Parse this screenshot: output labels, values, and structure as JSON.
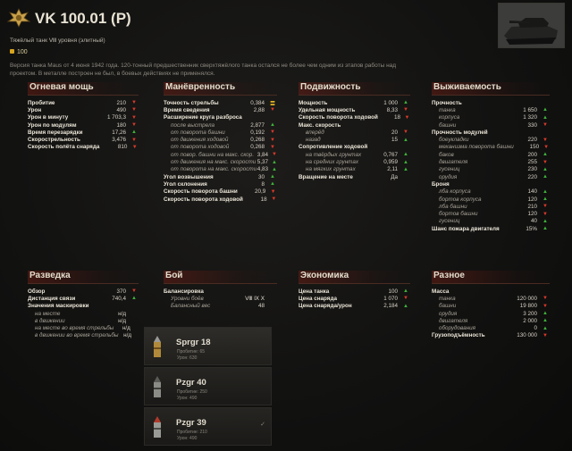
{
  "header": {
    "title": "VK 100.01 (P)",
    "subtitle": "Тяжёлый танк Ⅷ уровня (элитный)",
    "price": "100",
    "description": "Версия танка Maus от 4 июня 1942 года. 120-тонный предшественник сверхтяжёлого танка остался не более чем одним из этапов работы над проектом. В металле построен не был, в боевых действиях не применялся."
  },
  "sections": [
    {
      "id": "firepower",
      "title": "Огневая мощь",
      "rows": [
        {
          "label": "Пробитие",
          "value": "210",
          "ind": "down",
          "type": "bold"
        },
        {
          "label": "Урон",
          "value": "490",
          "ind": "down",
          "type": "bold"
        },
        {
          "label": "Урон в минуту",
          "value": "1 703,3",
          "ind": "down",
          "type": "bold"
        },
        {
          "label": "Урон по модулям",
          "value": "180",
          "ind": "down",
          "type": "bold"
        },
        {
          "label": "Время перезарядки",
          "value": "17,26",
          "ind": "up",
          "type": "bold"
        },
        {
          "label": "Скорострельность",
          "value": "3,476",
          "ind": "down",
          "type": "bold"
        },
        {
          "label": "Скорость полёта снаряда",
          "value": "810",
          "ind": "down",
          "type": "bold"
        }
      ]
    },
    {
      "id": "mobility",
      "title": "Манёвренность",
      "rows": [
        {
          "label": "Точность стрельбы",
          "value": "0,384",
          "ind": "eq",
          "type": "bold"
        },
        {
          "label": "Время сведения",
          "value": "2,88",
          "ind": "down",
          "type": "bold"
        },
        {
          "label": "Расширение круга разброса",
          "value": "",
          "ind": "",
          "type": "bold"
        },
        {
          "label": "после выстрела",
          "value": "2,877",
          "ind": "up",
          "type": "sub"
        },
        {
          "label": "от поворота башни",
          "value": "0,192",
          "ind": "down",
          "type": "sub"
        },
        {
          "label": "от движения ходовой",
          "value": "0,268",
          "ind": "down",
          "type": "sub"
        },
        {
          "label": "от поворота ходовой",
          "value": "0,268",
          "ind": "down",
          "type": "sub"
        },
        {
          "label": "от повор. башни на макс. скор.",
          "value": "3,84",
          "ind": "down",
          "type": "sub"
        },
        {
          "label": "от движения на макс. скорости",
          "value": "5,37",
          "ind": "up",
          "type": "sub"
        },
        {
          "label": "от поворота на макс. скорости",
          "value": "4,83",
          "ind": "up",
          "type": "sub"
        },
        {
          "label": "Угол возвышения",
          "value": "30",
          "ind": "up",
          "type": "bold"
        },
        {
          "label": "Угол склонения",
          "value": "8",
          "ind": "up",
          "type": "bold"
        },
        {
          "label": "Скорость поворота башни",
          "value": "20,9",
          "ind": "down",
          "type": "bold"
        },
        {
          "label": "Скорость поворота ходовой",
          "value": "18",
          "ind": "down",
          "type": "bold"
        }
      ]
    },
    {
      "id": "speed",
      "title": "Подвижность",
      "rows": [
        {
          "label": "Мощность",
          "value": "1 000",
          "ind": "up",
          "type": "bold"
        },
        {
          "label": "Удельная мощность",
          "value": "8,33",
          "ind": "down",
          "type": "bold"
        },
        {
          "label": "Скорость поворота ходовой",
          "value": "18",
          "ind": "down",
          "type": "bold"
        },
        {
          "label": "Макс. скорость",
          "value": "",
          "ind": "",
          "type": "bold"
        },
        {
          "label": "вперёд",
          "value": "20",
          "ind": "down",
          "type": "sub"
        },
        {
          "label": "назад",
          "value": "15",
          "ind": "up",
          "type": "sub"
        },
        {
          "label": "Сопротивление ходовой",
          "value": "",
          "ind": "",
          "type": "bold"
        },
        {
          "label": "на твёрдых грунтах",
          "value": "0,767",
          "ind": "up",
          "type": "sub"
        },
        {
          "label": "на средних грунтах",
          "value": "0,959",
          "ind": "up",
          "type": "sub"
        },
        {
          "label": "на мягких грунтах",
          "value": "2,11",
          "ind": "up",
          "type": "sub"
        },
        {
          "label": "Вращение на месте",
          "value": "Да",
          "ind": "",
          "type": "bold"
        }
      ]
    },
    {
      "id": "survivability",
      "title": "Выживаемость",
      "rows": [
        {
          "label": "Прочность",
          "value": "",
          "ind": "",
          "type": "bold"
        },
        {
          "label": "танка",
          "value": "1 650",
          "ind": "up",
          "type": "sub"
        },
        {
          "label": "корпуса",
          "value": "1 320",
          "ind": "up",
          "type": "sub"
        },
        {
          "label": "башни",
          "value": "330",
          "ind": "down",
          "type": "sub"
        },
        {
          "label": "Прочность модулей",
          "value": "",
          "ind": "",
          "type": "bold"
        },
        {
          "label": "боеукладки",
          "value": "220",
          "ind": "down",
          "type": "sub"
        },
        {
          "label": "механизма поворота башни",
          "value": "150",
          "ind": "down",
          "type": "sub"
        },
        {
          "label": "баков",
          "value": "200",
          "ind": "up",
          "type": "sub"
        },
        {
          "label": "двигателя",
          "value": "255",
          "ind": "down",
          "type": "sub"
        },
        {
          "label": "гусениц",
          "value": "230",
          "ind": "up",
          "type": "sub"
        },
        {
          "label": "орудия",
          "value": "220",
          "ind": "up",
          "type": "sub"
        },
        {
          "label": "Броня",
          "value": "",
          "ind": "",
          "type": "bold"
        },
        {
          "label": "лба корпуса",
          "value": "140",
          "ind": "up",
          "type": "sub"
        },
        {
          "label": "бортов корпуса",
          "value": "120",
          "ind": "up",
          "type": "sub"
        },
        {
          "label": "лба башни",
          "value": "210",
          "ind": "down",
          "type": "sub"
        },
        {
          "label": "бортов башни",
          "value": "120",
          "ind": "down",
          "type": "sub"
        },
        {
          "label": "гусениц",
          "value": "40",
          "ind": "up",
          "type": "sub"
        },
        {
          "label": "Шанс пожара двигателя",
          "value": "15%",
          "ind": "up",
          "type": "bold"
        }
      ]
    },
    {
      "id": "recon",
      "title": "Разведка",
      "rows": [
        {
          "label": "Обзор",
          "value": "370",
          "ind": "down",
          "type": "bold"
        },
        {
          "label": "Дистанция связи",
          "value": "740,4",
          "ind": "up",
          "type": "bold"
        },
        {
          "label": "Значения маскировки",
          "value": "",
          "ind": "",
          "type": "bold"
        },
        {
          "label": "на месте",
          "value": "н/д",
          "ind": "",
          "type": "sub"
        },
        {
          "label": "в движении",
          "value": "н/д",
          "ind": "",
          "type": "sub"
        },
        {
          "label": "на месте во время стрельбы",
          "value": "н/д",
          "ind": "",
          "type": "sub"
        },
        {
          "label": "в движении во время стрельбы",
          "value": "н/д",
          "ind": "",
          "type": "sub"
        }
      ]
    },
    {
      "id": "battle",
      "title": "Бой",
      "rows": [
        {
          "label": "Балансировка",
          "value": "",
          "ind": "",
          "type": "bold"
        },
        {
          "label": "Уровни боёв",
          "value": "Ⅷ Ⅸ Ⅹ",
          "ind": "",
          "type": "sub"
        },
        {
          "label": "Балансный вес",
          "value": "48",
          "ind": "",
          "type": "sub"
        }
      ]
    },
    {
      "id": "economy",
      "title": "Экономика",
      "rows": [
        {
          "label": "Цена танка",
          "value": "100",
          "ind": "up",
          "type": "bold"
        },
        {
          "label": "Цена снаряда",
          "value": "1 070",
          "ind": "down",
          "type": "bold"
        },
        {
          "label": "Цена снаряда/урон",
          "value": "2,184",
          "ind": "up",
          "type": "bold"
        }
      ]
    },
    {
      "id": "misc",
      "title": "Разное",
      "rows": [
        {
          "label": "Масса",
          "value": "",
          "ind": "",
          "type": "bold"
        },
        {
          "label": "танка",
          "value": "120 000",
          "ind": "down",
          "type": "sub"
        },
        {
          "label": "башни",
          "value": "19 800",
          "ind": "down",
          "type": "sub"
        },
        {
          "label": "орудия",
          "value": "3 200",
          "ind": "up",
          "type": "sub"
        },
        {
          "label": "двигателя",
          "value": "2 000",
          "ind": "up",
          "type": "sub"
        },
        {
          "label": "оборудования",
          "value": "0",
          "ind": "up",
          "type": "sub"
        },
        {
          "label": "Грузоподъёмность",
          "value": "130 000",
          "ind": "down",
          "type": "bold"
        }
      ]
    }
  ],
  "shells": [
    {
      "name": "Sprgr 18",
      "d1": "Пробитие: 65",
      "d2": "Урон: 630",
      "active": true,
      "check": ""
    },
    {
      "name": "Pzgr 40",
      "d1": "Пробитие: 250",
      "d2": "Урон: 490",
      "active": false,
      "check": ""
    },
    {
      "name": "Pzgr 39",
      "d1": "Пробитие: 210",
      "d2": "Урон: 490",
      "active": false,
      "check": "✓"
    }
  ],
  "colors": {
    "up": "#3fb23a",
    "down": "#d93a2a",
    "eq": "#e0b422",
    "header_accent": "#7a1e14"
  }
}
